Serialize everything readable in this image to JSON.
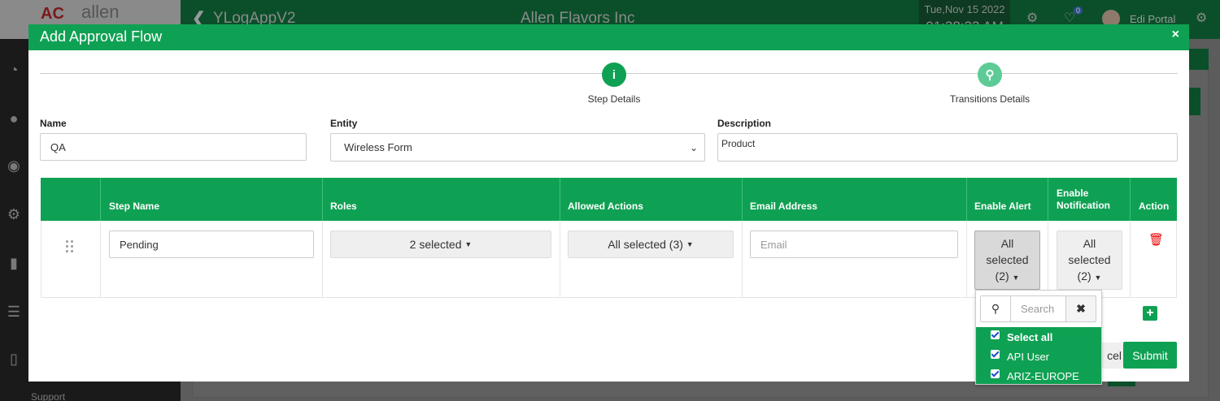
{
  "background": {
    "logo_mark": "AC",
    "logo_word": "allen",
    "app_name": "YLogAppV2",
    "company": "Allen Flavors Inc",
    "date": "Tue,Nov 15 2022",
    "time": "01:38:33 AM",
    "notification_count": "0",
    "user_name": "Edi Portal",
    "sidebar_support": "Support"
  },
  "modal": {
    "title": "Add Approval Flow",
    "close_label": "×",
    "steps": [
      {
        "label": "Step Details",
        "icon": "info-icon",
        "color": "#0fa153"
      },
      {
        "label": "Transitions Details",
        "icon": "key-icon",
        "color": "#5ccb95"
      }
    ],
    "form": {
      "name_label": "Name",
      "name_value": "QA",
      "entity_label": "Entity",
      "entity_value": "Wireless Form",
      "description_label": "Description",
      "description_value": "Product"
    },
    "table": {
      "headers": [
        "Step Name",
        "Roles",
        "Allowed Actions",
        "Email Address",
        "Enable Alert",
        "Enable Notification",
        "Action"
      ],
      "row": {
        "step_name": "Pending",
        "roles": "2 selected",
        "allowed_actions": "All selected (3)",
        "email_placeholder": "Email",
        "enable_alert_l1": "All",
        "enable_alert_l2": "selected",
        "enable_alert_l3": "(2)",
        "enable_notification_l1": "All",
        "enable_notification_l2": "selected",
        "enable_notification_l3": "(2)"
      }
    },
    "dropdown": {
      "search_placeholder": "Search",
      "items": [
        "Select all",
        "API User",
        "ARIZ-EUROPE"
      ]
    },
    "buttons": {
      "cancel": "cel",
      "submit": "Submit"
    }
  },
  "colors": {
    "primary_green": "#0fa153",
    "delete_red": "#e00000"
  }
}
